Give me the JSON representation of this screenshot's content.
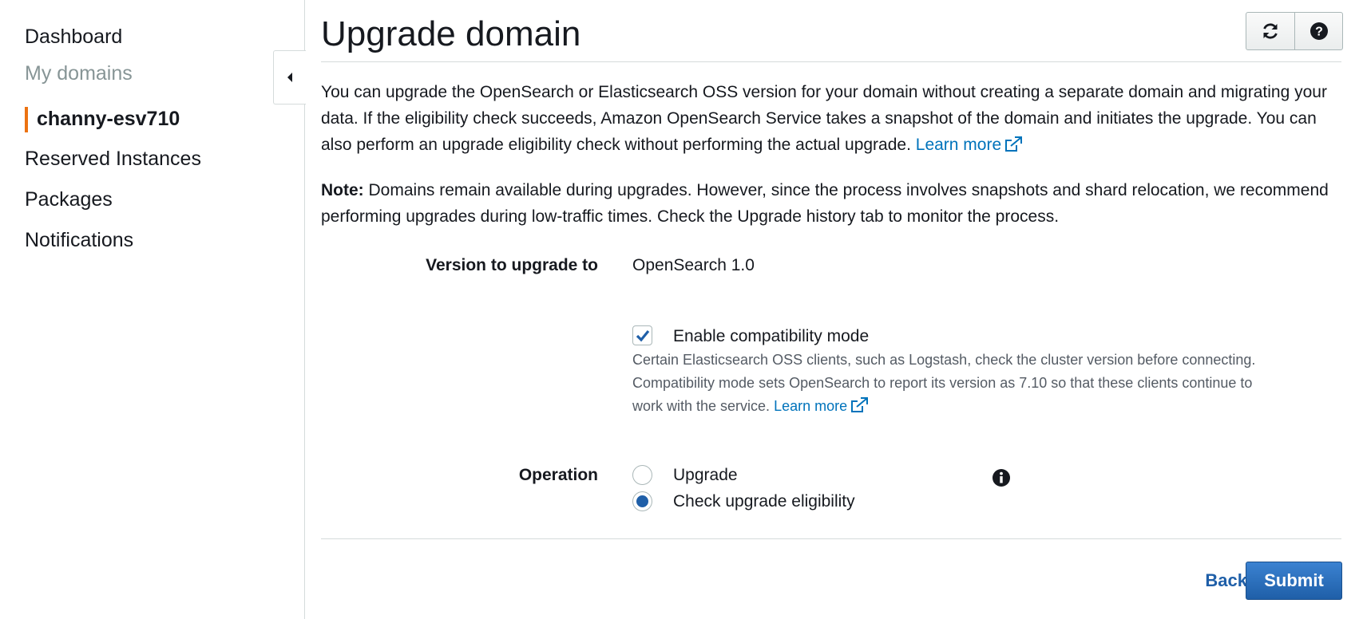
{
  "sidebar": {
    "items": [
      {
        "label": "Dashboard"
      },
      {
        "label": "My domains"
      },
      {
        "label": "channy-esv710"
      },
      {
        "label": "Reserved Instances"
      },
      {
        "label": "Packages"
      },
      {
        "label": "Notifications"
      }
    ],
    "collapse_icon": "caret-left-icon"
  },
  "header": {
    "title": "Upgrade domain",
    "refresh_icon": "refresh-icon",
    "help_icon": "help-icon"
  },
  "intro": {
    "text": "You can upgrade the OpenSearch or Elasticsearch OSS version for your domain without creating a separate domain and migrating your data. If the eligibility check succeeds, Amazon OpenSearch Service takes a snapshot of the domain and initiates the upgrade. You can also perform an upgrade eligibility check without performing the actual upgrade.",
    "link": "Learn more"
  },
  "note": {
    "label": "Note:",
    "text": "Domains remain available during upgrades. However, since the process involves snapshots and shard relocation, we recommend performing upgrades during low-traffic times. Check the Upgrade history tab to monitor the process."
  },
  "form": {
    "version_label": "Version to upgrade to",
    "version_value": "OpenSearch 1.0",
    "compat_label": "Enable compatibility mode",
    "compat_checked": true,
    "compat_desc": "Certain Elasticsearch OSS clients, such as Logstash, check the cluster version before connecting. Compatibility mode sets OpenSearch to report its version as 7.10 so that these clients continue to work with the service.",
    "compat_link": "Learn more",
    "operation_label": "Operation",
    "operations": [
      {
        "label": "Upgrade",
        "selected": false
      },
      {
        "label": "Check upgrade eligibility",
        "selected": true
      }
    ]
  },
  "footer": {
    "back_label": "Back",
    "submit_label": "Submit"
  },
  "colors": {
    "accent": "#ec7211",
    "link": "#0073bb",
    "primary": "#1f5fa8"
  }
}
